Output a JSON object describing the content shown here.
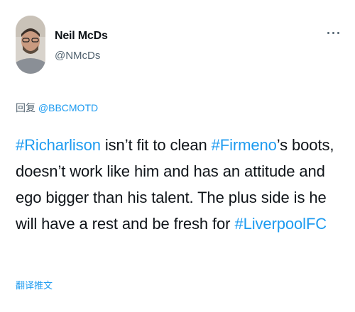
{
  "author": {
    "display_name": "Neil McDs",
    "handle": "@NMcDs"
  },
  "reply": {
    "prefix": "回复 ",
    "mention": "@BBCMOTD"
  },
  "tweet": {
    "hashtag_1": "#Richarlison",
    "text_1": " isn’t fit to clean ",
    "hashtag_2": "#Firmeno",
    "text_2": "’s boots, doesn’t work like him and has an attitude and ego bigger than his talent. The plus side is he will have a rest and be fresh for ",
    "hashtag_3": "#LiverpoolFC"
  },
  "translate_label": "翻译推文",
  "icons": {
    "more": "more-dots-icon"
  },
  "colors": {
    "link": "#1d9bf0",
    "text": "#0f1419",
    "secondary": "#536471"
  }
}
